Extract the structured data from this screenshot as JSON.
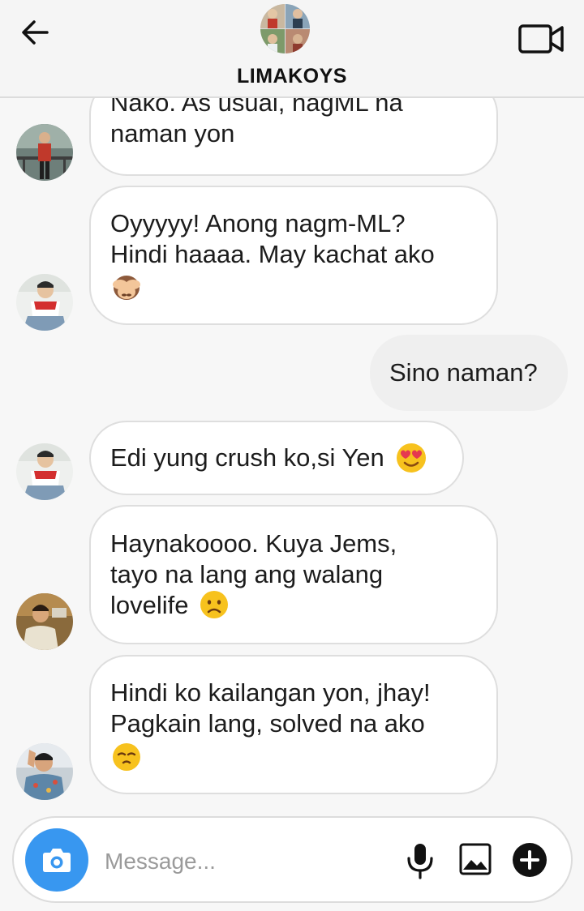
{
  "header": {
    "title": "LIMAKOYS",
    "back_icon": "arrow-left-icon",
    "video_icon": "video-camera-icon"
  },
  "messages": [
    {
      "sender": "incoming",
      "avatar": "avatar-1",
      "lines": [
        "Nako. As usual, nagML na",
        "naman yon"
      ],
      "emoji": null
    },
    {
      "sender": "incoming",
      "avatar": "avatar-2",
      "lines": [
        "Oyyyyy! Anong nagm-ML?",
        "Hindi haaaa. May kachat ako"
      ],
      "emoji": "see-no-evil-monkey"
    },
    {
      "sender": "outgoing",
      "lines": [
        "Sino naman?"
      ],
      "emoji": null
    },
    {
      "sender": "incoming",
      "avatar": "avatar-2",
      "lines": [
        "Edi yung crush ko,si Yen"
      ],
      "emoji": "heart-eyes"
    },
    {
      "sender": "incoming",
      "avatar": "avatar-3",
      "lines": [
        "Haynakoooo. Kuya Jems,",
        "tayo na lang ang walang",
        "lovelife"
      ],
      "emoji": "frowning-face"
    },
    {
      "sender": "incoming",
      "avatar": "avatar-4",
      "lines": [
        "Hindi ko kailangan yon, jhay!",
        "Pagkain lang, solved na ako"
      ],
      "emoji": "smug-face"
    }
  ],
  "composer": {
    "placeholder": "Message...",
    "camera_icon": "camera-icon",
    "mic_icon": "microphone-icon",
    "gallery_icon": "gallery-icon",
    "plus_icon": "plus-circle-icon"
  },
  "colors": {
    "accent": "#3897f0",
    "emoji_yellow": "#f7c21e"
  }
}
